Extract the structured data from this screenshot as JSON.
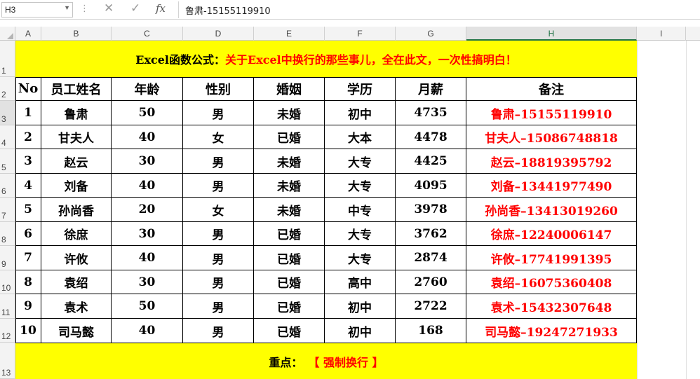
{
  "name_box": "H3",
  "formula_bar": {
    "cancel_icon": "✕",
    "enter_icon": "✓",
    "fx_label": "fx",
    "content": "鲁肃-15155119910"
  },
  "columns": [
    "A",
    "B",
    "C",
    "D",
    "E",
    "F",
    "G",
    "H",
    "I"
  ],
  "rows": [
    "1",
    "2",
    "3",
    "4",
    "5",
    "6",
    "7",
    "8",
    "9",
    "10",
    "11",
    "12",
    "13"
  ],
  "title": {
    "part1": "Excel函数公式：",
    "part2": "关于Excel中换行的那些事儿，全在此文，一次性搞明白！"
  },
  "table": {
    "headers": [
      "No",
      "员工姓名",
      "年龄",
      "性别",
      "婚姻",
      "学历",
      "月薪",
      "备注"
    ],
    "rows": [
      [
        "1",
        "鲁肃",
        "50",
        "男",
        "未婚",
        "初中",
        "4735",
        "鲁肃–15155119910"
      ],
      [
        "2",
        "甘夫人",
        "40",
        "女",
        "已婚",
        "大本",
        "4478",
        "甘夫人–15086748818"
      ],
      [
        "3",
        "赵云",
        "30",
        "男",
        "未婚",
        "大专",
        "4425",
        "赵云–18819395792"
      ],
      [
        "4",
        "刘备",
        "40",
        "男",
        "未婚",
        "大专",
        "4095",
        "刘备–13441977490"
      ],
      [
        "5",
        "孙尚香",
        "20",
        "女",
        "未婚",
        "中专",
        "3978",
        "孙尚香–13413019260"
      ],
      [
        "6",
        "徐庶",
        "30",
        "男",
        "已婚",
        "大专",
        "3762",
        "徐庶–12240006147"
      ],
      [
        "7",
        "许攸",
        "40",
        "男",
        "已婚",
        "大专",
        "2874",
        "许攸–17741991395"
      ],
      [
        "8",
        "袁绍",
        "30",
        "男",
        "已婚",
        "高中",
        "2760",
        "袁绍–16075360408"
      ],
      [
        "9",
        "袁术",
        "50",
        "男",
        "已婚",
        "初中",
        "2722",
        "袁术–15432307648"
      ],
      [
        "10",
        "司马懿",
        "40",
        "男",
        "已婚",
        "初中",
        "168",
        "司马懿–19247271933"
      ]
    ]
  },
  "footer": {
    "label": "重点：",
    "value": "【 强制换行 】"
  },
  "colors": {
    "banner_bg": "#ffff00",
    "accent_red": "#ff0000"
  }
}
